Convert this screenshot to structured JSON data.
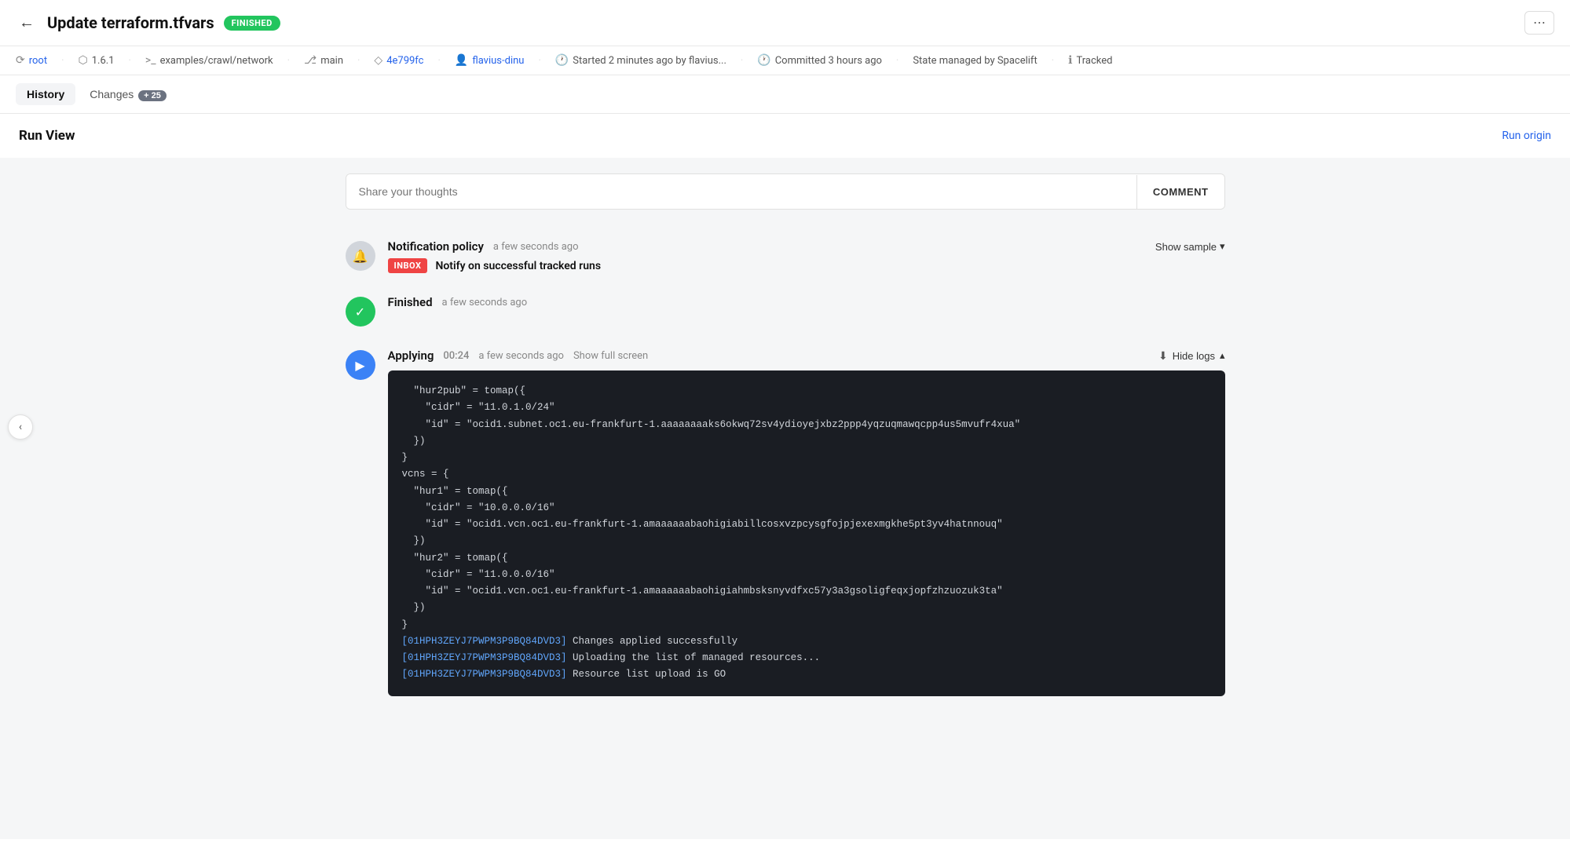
{
  "header": {
    "back_label": "←",
    "title": "Update terraform.tfvars",
    "status": "FINISHED",
    "more_icon": "⋯"
  },
  "meta": {
    "items": [
      {
        "icon": "⟳",
        "text": "root",
        "link": true
      },
      {
        "icon": "⬡",
        "text": "1.6.1",
        "link": false
      },
      {
        "icon": ">_",
        "text": "examples/crawl/network",
        "link": false
      },
      {
        "icon": "⎇",
        "text": "main",
        "link": false
      },
      {
        "icon": "◇",
        "text": "4e799fc",
        "link": true
      },
      {
        "icon": "👤",
        "text": "flavius-dinu",
        "link": true
      },
      {
        "icon": "🕐",
        "text": "Started 2 minutes ago by flavius...",
        "link": false
      },
      {
        "icon": "🕐",
        "text": "Committed 3 hours ago",
        "link": false
      },
      {
        "icon": "",
        "text": "State managed by Spacelift",
        "link": false
      },
      {
        "icon": "ℹ",
        "text": "Tracked",
        "link": false
      }
    ]
  },
  "tabs": {
    "items": [
      {
        "label": "History",
        "active": true
      },
      {
        "label": "Changes",
        "active": false
      },
      {
        "badge": "+ 25"
      }
    ]
  },
  "run_view": {
    "title": "Run View",
    "run_origin_label": "Run origin"
  },
  "comment": {
    "placeholder": "Share your thoughts",
    "button_label": "COMMENT"
  },
  "timeline": {
    "items": [
      {
        "type": "notification",
        "icon": "🔔",
        "title": "Notification policy",
        "time": "a few seconds ago",
        "show_sample_label": "Show sample",
        "notification": {
          "badge": "INBOX",
          "text": "Notify on successful tracked runs"
        }
      },
      {
        "type": "finished",
        "icon": "✓",
        "title": "Finished",
        "time": "a few seconds ago"
      },
      {
        "type": "applying",
        "icon": "▶",
        "title": "Applying",
        "duration": "00:24",
        "time": "a few seconds ago",
        "fullscreen_label": "Show full screen",
        "download_icon": "⬇",
        "hide_logs_label": "Hide logs",
        "log_lines": [
          {
            "plain": "  \"hur2pub\" = tomap({"
          },
          {
            "plain": "    \"cidr\" = \"11.0.1.0/24\""
          },
          {
            "plain": "    \"id\" = \"ocid1.subnet.oc1.eu-frankfurt-1.aaaaaaaaks6okwq72sv4ydioyejxbz2ppp4yqzuqmawqcpp4us5mvufr4xua\""
          },
          {
            "plain": "  })"
          },
          {
            "plain": "}"
          },
          {
            "plain": "vcns = {"
          },
          {
            "plain": "  \"hur1\" = tomap({"
          },
          {
            "plain": "    \"cidr\" = \"10.0.0.0/16\""
          },
          {
            "plain": "    \"id\" = \"ocid1.vcn.oc1.eu-frankfurt-1.amaaaaaabaohigiabillcosxvzpcysgfojpjexexmgkhe5pt3yv4hatnnouq\""
          },
          {
            "plain": "  })"
          },
          {
            "plain": "  \"hur2\" = tomap({"
          },
          {
            "plain": "    \"cidr\" = \"11.0.0.0/16\""
          },
          {
            "plain": "    \"id\" = \"ocid1.vcn.oc1.eu-frankfurt-1.amaaaaaabaohigiahmbsksnyvdfxc57y3a3gsoligfeqxjopfzhzuozuk3ta\""
          },
          {
            "plain": "  })"
          },
          {
            "plain": "}"
          },
          {
            "id": "[01HPH3ZEYJ7PWPM3P9BQ84DVD3]",
            "text": " Changes applied successfully"
          },
          {
            "id": "[01HPH3ZEYJ7PWPM3P9BQ84DVD3]",
            "text": " Uploading the list of managed resources..."
          },
          {
            "id": "[01HPH3ZEYJ7PWPM3P9BQ84DVD3]",
            "text": " Resource list upload is GO"
          }
        ]
      }
    ]
  },
  "collapse_nav": {
    "icon": "‹"
  }
}
